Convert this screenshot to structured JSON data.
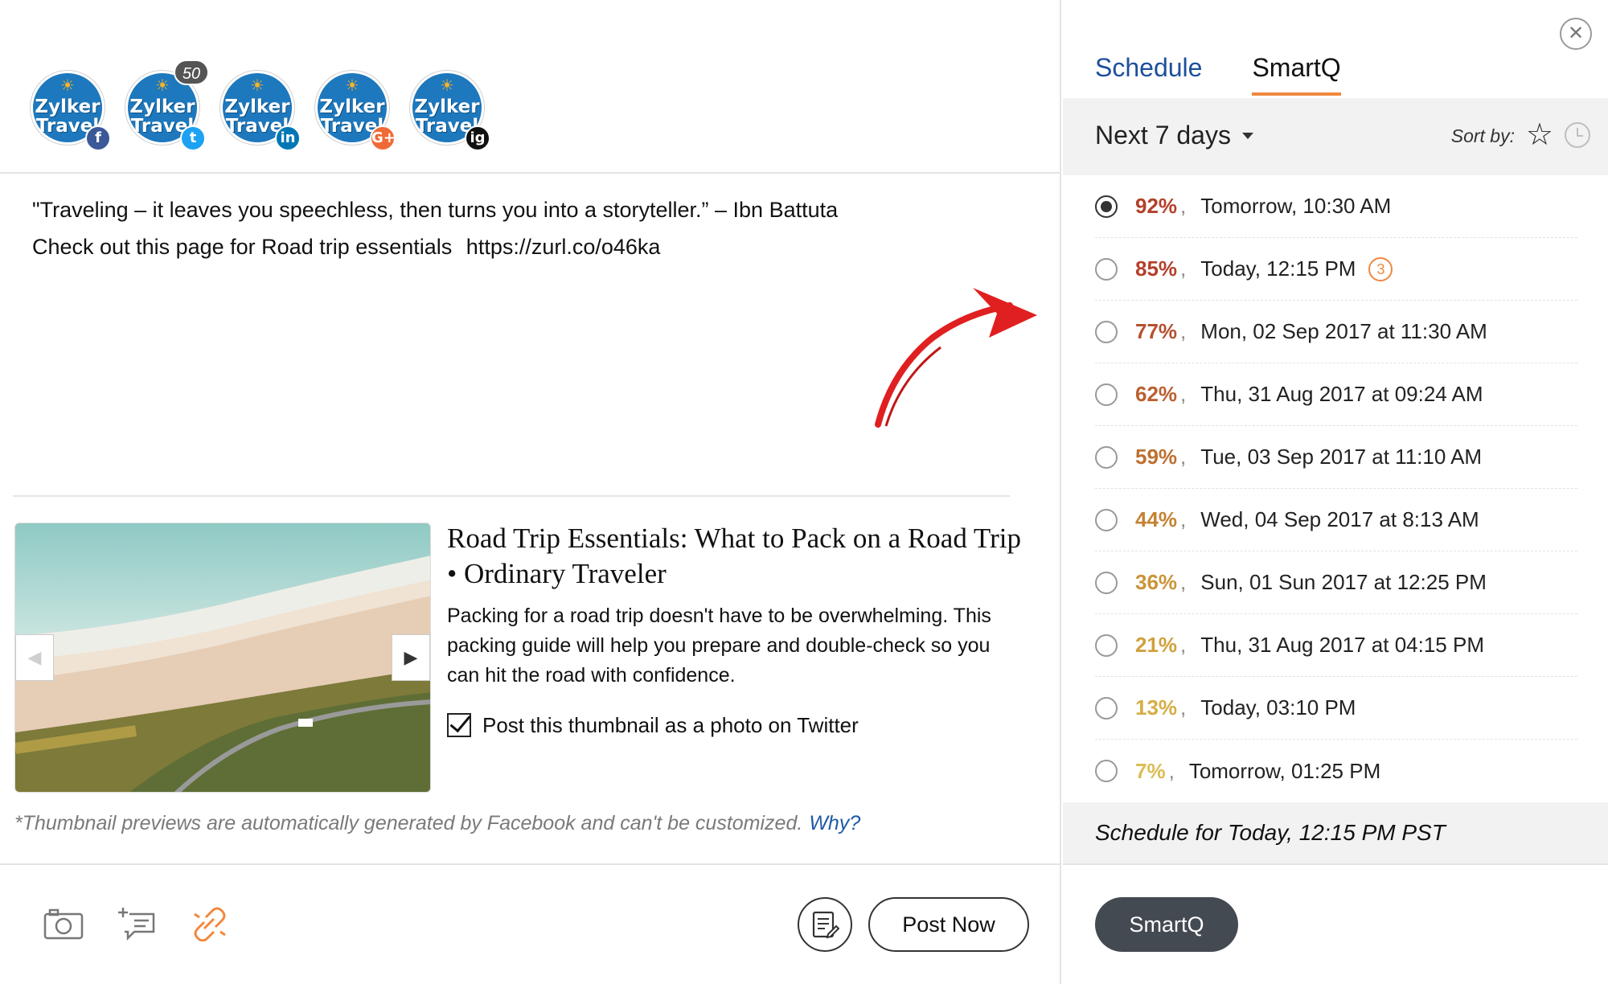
{
  "profiles": [
    {
      "logo_line1": "Zylker",
      "logo_line2": "Travel",
      "network": "facebook",
      "network_icon": "f",
      "network_color": "#3b5998",
      "count": null
    },
    {
      "logo_line1": "Zylker",
      "logo_line2": "Travel",
      "network": "twitter",
      "network_icon": "t",
      "network_color": "#1da1f2",
      "count": "50"
    },
    {
      "logo_line1": "Zylker",
      "logo_line2": "Travel",
      "network": "linkedin",
      "network_icon": "in",
      "network_color": "#0077b5",
      "count": null
    },
    {
      "logo_line1": "Zylker",
      "logo_line2": "Travel",
      "network": "google-plus",
      "network_icon": "G+",
      "network_color": "#f06a35",
      "count": null
    },
    {
      "logo_line1": "Zylker",
      "logo_line2": "Travel",
      "network": "instagram",
      "network_icon": "ig",
      "network_color": "#111111",
      "count": null
    }
  ],
  "post": {
    "line1": "\"Traveling – it leaves you speechless, then turns you into a storyteller.” – Ibn Battuta",
    "line2_text": "Check out this page for Road trip essentials",
    "line2_url": "https://zurl.co/o46ka"
  },
  "preview": {
    "title": "Road Trip Essentials: What to Pack on a Road Trip • Ordinary Traveler",
    "description": "Packing for a road trip doesn't have to be overwhelming. This packing guide will help you prepare and double-check so you can hit the road with confidence.",
    "thumbnail_checkbox_label": "Post this thumbnail as a photo on Twitter",
    "thumbnail_checked": true,
    "prev_icon": "◀",
    "next_icon": "▶"
  },
  "footnote": {
    "text": "*Thumbnail previews are automatically generated by Facebook and can't be customized.",
    "link": "Why?"
  },
  "toolbar": {
    "tools": [
      "camera-icon",
      "add-comment-icon",
      "unlink-icon"
    ],
    "post_now_label": "Post Now"
  },
  "panel": {
    "close_icon": "✕",
    "tabs": [
      {
        "label": "Schedule",
        "active": false
      },
      {
        "label": "SmartQ",
        "active": true
      }
    ],
    "range": "Next 7 days",
    "sort_label": "Sort by:",
    "sort_star_icon": "☆",
    "slots": [
      {
        "percent": "92%",
        "time": "Tomorrow, 10:30 AM",
        "selected": true,
        "color": "#b3402b",
        "badge": null
      },
      {
        "percent": "85%",
        "time": "Today, 12:15 PM",
        "selected": false,
        "color": "#b3402b",
        "badge": "3"
      },
      {
        "percent": "77%",
        "time": "Mon, 02 Sep 2017 at 11:30 AM",
        "selected": false,
        "color": "#b5512e",
        "badge": null
      },
      {
        "percent": "62%",
        "time": "Thu, 31 Aug 2017 at 09:24 AM",
        "selected": false,
        "color": "#b9602f",
        "badge": null
      },
      {
        "percent": "59%",
        "time": "Tue, 03 Sep 2017 at 11:10 AM",
        "selected": false,
        "color": "#bd7030",
        "badge": null
      },
      {
        "percent": "44%",
        "time": "Wed, 04 Sep 2017 at 8:13 AM",
        "selected": false,
        "color": "#c48234",
        "badge": null
      },
      {
        "percent": "36%",
        "time": "Sun, 01 Sun 2017 at 12:25 PM",
        "selected": false,
        "color": "#cb9438",
        "badge": null
      },
      {
        "percent": "21%",
        "time": "Thu, 31 Aug 2017 at 04:15 PM",
        "selected": false,
        "color": "#d1a03d",
        "badge": null
      },
      {
        "percent": "13%",
        "time": "Today, 03:10 PM",
        "selected": false,
        "color": "#d6ad45",
        "badge": null
      },
      {
        "percent": "7%",
        "time": "Tomorrow, 01:25 PM",
        "selected": false,
        "color": "#dcbd52",
        "badge": null
      }
    ],
    "schedule_summary": "Schedule for Today, 12:15 PM  PST",
    "smartq_button": "SmartQ"
  }
}
